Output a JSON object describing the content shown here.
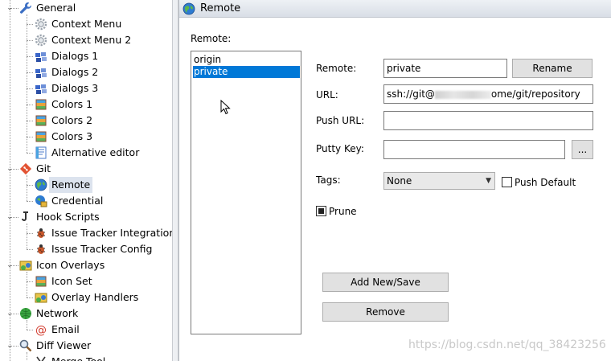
{
  "tree": {
    "items": [
      {
        "label": "General",
        "icon": "wrench-icon",
        "level": 1,
        "expanded": true
      },
      {
        "label": "Context Menu",
        "icon": "gear-icon",
        "level": 2
      },
      {
        "label": "Context Menu 2",
        "icon": "gear-icon",
        "level": 2
      },
      {
        "label": "Dialogs 1",
        "icon": "dialogs-icon",
        "level": 2
      },
      {
        "label": "Dialogs 2",
        "icon": "dialogs-icon",
        "level": 2
      },
      {
        "label": "Dialogs 3",
        "icon": "dialogs-icon",
        "level": 2
      },
      {
        "label": "Colors 1",
        "icon": "colors-icon",
        "level": 2
      },
      {
        "label": "Colors 2",
        "icon": "colors-icon",
        "level": 2
      },
      {
        "label": "Colors 3",
        "icon": "colors-icon",
        "level": 2
      },
      {
        "label": "Alternative editor",
        "icon": "editor-icon",
        "level": 2
      },
      {
        "label": "Git",
        "icon": "git-icon",
        "level": 1,
        "expanded": true
      },
      {
        "label": "Remote",
        "icon": "globe-icon",
        "level": 2,
        "selected": true
      },
      {
        "label": "Credential",
        "icon": "credential-icon",
        "level": 2
      },
      {
        "label": "Hook Scripts",
        "icon": "hook-icon",
        "level": 1,
        "expanded": true
      },
      {
        "label": "Issue Tracker Integration",
        "icon": "bug-icon",
        "level": 2
      },
      {
        "label": "Issue Tracker Config",
        "icon": "bug-icon",
        "level": 2
      },
      {
        "label": "Icon Overlays",
        "icon": "overlay-icon",
        "level": 1,
        "expanded": true
      },
      {
        "label": "Icon Set",
        "icon": "colors-icon",
        "level": 2
      },
      {
        "label": "Overlay Handlers",
        "icon": "overlay-icon",
        "level": 2
      },
      {
        "label": "Network",
        "icon": "network-icon",
        "level": 1,
        "expanded": true
      },
      {
        "label": "Email",
        "icon": "at-icon",
        "level": 2
      },
      {
        "label": "Diff Viewer",
        "icon": "magnifier-icon",
        "level": 1,
        "expanded": true
      },
      {
        "label": "Merge Tool",
        "icon": "merge-icon",
        "level": 2
      }
    ]
  },
  "panel": {
    "title": "Remote",
    "remote_list_label": "Remote:",
    "remotes": [
      "origin",
      "private"
    ],
    "selected_remote": "private",
    "remote_label": "Remote:",
    "remote_value": "private",
    "rename_button": "Rename",
    "url_label": "URL:",
    "url_prefix": "ssh://git@",
    "url_suffix": "ome/git/repository",
    "push_url_label": "Push URL:",
    "push_url_value": "",
    "putty_key_label": "Putty Key:",
    "putty_key_value": "",
    "browse_button": "...",
    "tags_label": "Tags:",
    "tags_value": "None",
    "push_default_label": "Push Default",
    "push_default_checked": false,
    "prune_label": "Prune",
    "prune_checked": true,
    "add_button": "Add New/Save",
    "remove_button": "Remove"
  },
  "watermark": "https://blog.csdn.net/qq_38423256",
  "colors": {
    "selection": "#0078d7",
    "tree_selection": "#dce3ee",
    "header_gradient": "#d9dee6"
  }
}
